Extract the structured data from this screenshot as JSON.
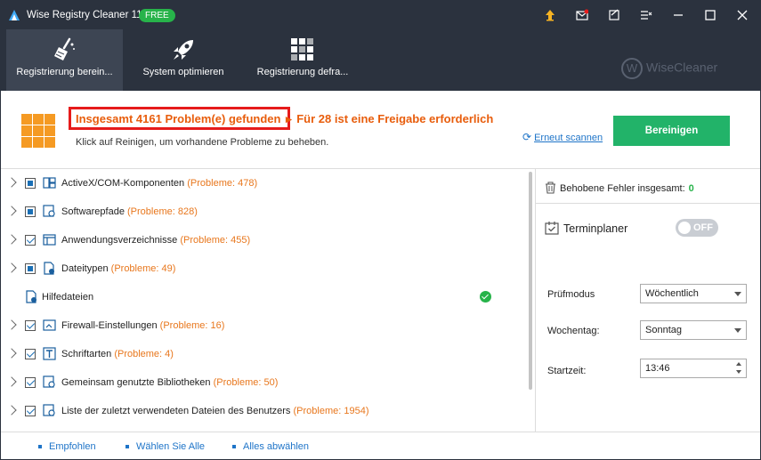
{
  "window": {
    "title": "Wise Registry Cleaner 11",
    "badge": "FREE",
    "controls": [
      "upgrade-icon",
      "mail-icon",
      "feedback-icon",
      "menu-icon",
      "minimize-icon",
      "maximize-icon",
      "close-icon"
    ]
  },
  "toolbar": {
    "tabs": [
      {
        "label": "Registrierung berein...",
        "icon": "broom-icon",
        "active": true
      },
      {
        "label": "System optimieren",
        "icon": "rocket-icon",
        "active": false
      },
      {
        "label": "Registrierung defra...",
        "icon": "defrag-icon",
        "active": false
      }
    ],
    "brand": "WiseCleaner",
    "brand_mark": "W"
  },
  "summary": {
    "headline": "Insgesamt 4161 Problem(e) gefunden",
    "headline_extra": "Für 28 ist eine Freigabe erforderlich",
    "subline": "Klick auf Reinigen, um vorhandene Probleme zu beheben.",
    "rescan_label": "Erneut scannen",
    "clean_button": "Bereinigen"
  },
  "items": [
    {
      "label": "ActiveX/COM-Komponenten",
      "problems": "(Probleme: 478)",
      "state": "partial",
      "expandable": true
    },
    {
      "label": "Softwarepfade",
      "problems": "(Probleme: 828)",
      "state": "partial",
      "expandable": true
    },
    {
      "label": "Anwendungsverzeichnisse",
      "problems": "(Probleme: 455)",
      "state": "checked",
      "expandable": true
    },
    {
      "label": "Dateitypen",
      "problems": "(Probleme: 49)",
      "state": "partial",
      "expandable": true
    },
    {
      "label": "Hilfedateien",
      "problems": "",
      "state": "ok",
      "expandable": false
    },
    {
      "label": "Firewall-Einstellungen",
      "problems": "(Probleme: 16)",
      "state": "checked",
      "expandable": true
    },
    {
      "label": "Schriftarten",
      "problems": "(Probleme: 4)",
      "state": "checked",
      "expandable": true
    },
    {
      "label": "Gemeinsam genutzte Bibliotheken",
      "problems": "(Probleme: 50)",
      "state": "checked",
      "expandable": true
    },
    {
      "label": "Liste der zuletzt verwendeten Dateien des Benutzers",
      "problems": "(Probleme: 1954)",
      "state": "checked",
      "expandable": true
    }
  ],
  "right_panel": {
    "fixed_label": "Behobene Fehler insgesamt:",
    "fixed_count": "0",
    "scheduler_label": "Terminplaner",
    "toggle_label": "OFF",
    "mode_label": "Prüfmodus",
    "mode_value": "Wöchentlich",
    "day_label": "Wochentag:",
    "day_value": "Sonntag",
    "time_label": "Startzeit:",
    "time_value": "13:46"
  },
  "footer": {
    "recommended": "Empfohlen",
    "select_all": "Wählen Sie Alle",
    "deselect_all": "Alles abwählen"
  },
  "colors": {
    "titlebar": "#2b323e",
    "accent_orange": "#e85d0c",
    "clean_green": "#22b369",
    "link_blue": "#1e74c8",
    "highlight_red": "#e61b1b"
  }
}
